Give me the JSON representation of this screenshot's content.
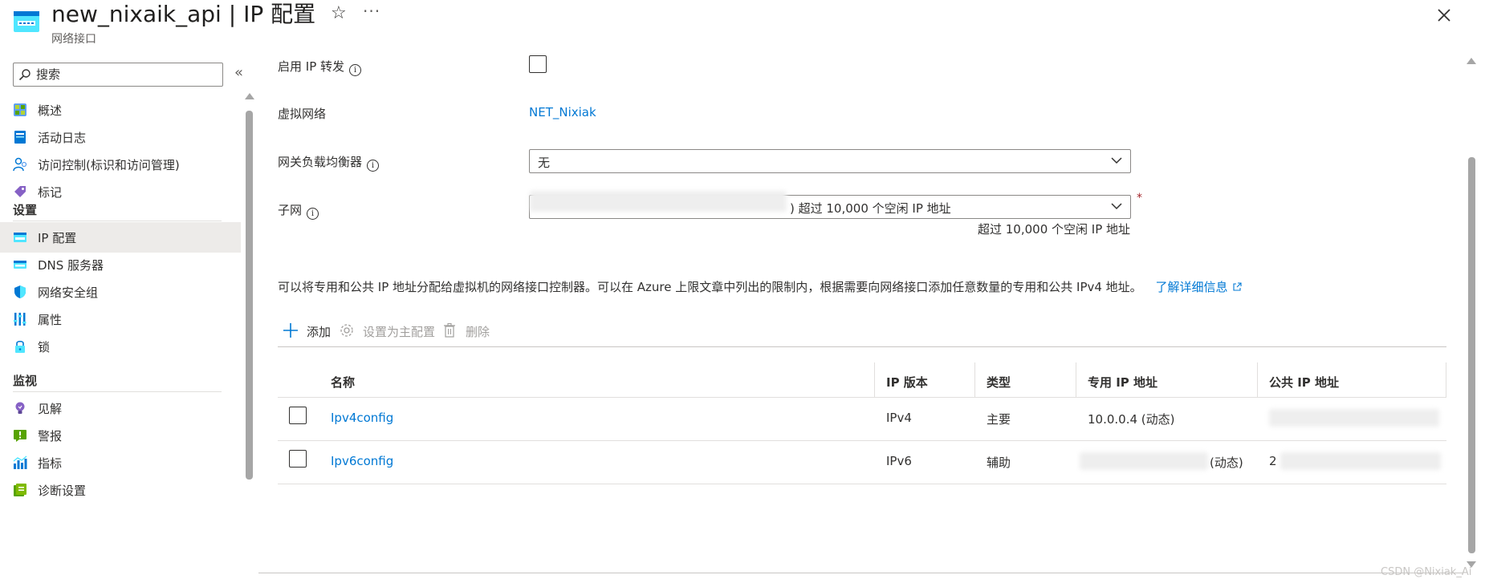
{
  "header": {
    "title": "new_nixaik_api | IP 配置",
    "subtitle": "网络接口",
    "more": "···"
  },
  "sidebar": {
    "search_placeholder": "搜索",
    "collapse": "«",
    "items": [
      {
        "label": "概述",
        "icon": "overview-icon"
      },
      {
        "label": "活动日志",
        "icon": "activity-log-icon"
      },
      {
        "label": "访问控制(标识和访问管理)",
        "icon": "access-control-icon"
      },
      {
        "label": "标记",
        "icon": "tag-icon"
      }
    ],
    "section_settings": "设置",
    "settings_items": [
      {
        "label": "IP 配置",
        "icon": "ip-config-icon",
        "selected": true
      },
      {
        "label": "DNS 服务器",
        "icon": "dns-icon"
      },
      {
        "label": "网络安全组",
        "icon": "shield-icon"
      },
      {
        "label": "属性",
        "icon": "properties-icon"
      },
      {
        "label": "锁",
        "icon": "lock-icon"
      }
    ],
    "section_monitor": "监视",
    "monitor_items": [
      {
        "label": "见解",
        "icon": "insights-icon"
      },
      {
        "label": "警报",
        "icon": "alert-icon"
      },
      {
        "label": "指标",
        "icon": "metrics-icon"
      },
      {
        "label": "诊断设置",
        "icon": "diagnostics-icon"
      }
    ]
  },
  "form": {
    "ip_forwarding_label": "启用 IP 转发",
    "vnet_label": "虚拟网络",
    "vnet_value": "NET_Nixiak",
    "gw_lb_label": "网关负载均衡器",
    "gw_lb_value": "无",
    "subnet_label": "子网",
    "subnet_value": ") 超过 10,000 个空闲 IP 地址",
    "subnet_hint": "超过 10,000 个空闲 IP 地址",
    "required_mark": "*"
  },
  "description": "可以将专用和公共 IP 地址分配给虚拟机的网络接口控制器。可以在 Azure 上限文章中列出的限制内，根据需要向网络接口添加任意数量的专用和公共 IPv4 地址。",
  "learn_more": "了解详细信息",
  "toolbar": {
    "add": "添加",
    "set_primary": "设置为主配置",
    "delete": "删除"
  },
  "table": {
    "columns": [
      "名称",
      "IP 版本",
      "类型",
      "专用 IP 地址",
      "公共 IP 地址"
    ],
    "rows": [
      {
        "name": "Ipv4config",
        "version": "IPv4",
        "type": "主要",
        "private_ip": "10.0.0.4 (动态)",
        "public_ip": ""
      },
      {
        "name": "Ipv6config",
        "version": "IPv6",
        "type": "辅助",
        "private_ip": "(动态)",
        "public_ip": "2"
      }
    ]
  },
  "watermark": "CSDN @Nixiak_Ai",
  "colors": {
    "accent": "#0078d4",
    "selected_bg": "#edebe9",
    "text": "#323130"
  }
}
